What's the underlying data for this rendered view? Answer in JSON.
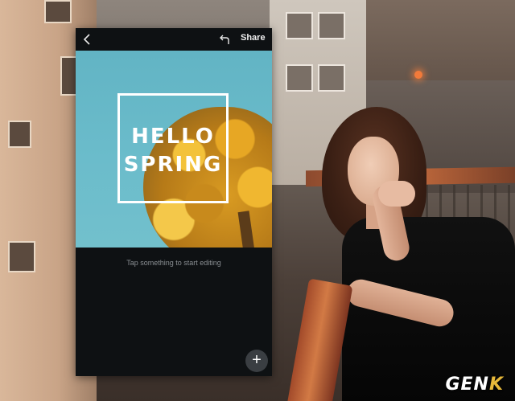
{
  "toolbar": {
    "back_icon": "chevron-left-icon",
    "undo_icon": "undo-icon",
    "share_label": "Share"
  },
  "canvas": {
    "title_line1": "HELLO",
    "title_line2": "SPRING",
    "sky_color": "#66b8c8",
    "foliage_color": "#e0a22a"
  },
  "hint_text": "Tap something to start editing",
  "add_button": {
    "icon": "plus-icon",
    "symbol": "+"
  },
  "watermark": {
    "text_main": "GEN",
    "text_accent": "K"
  }
}
